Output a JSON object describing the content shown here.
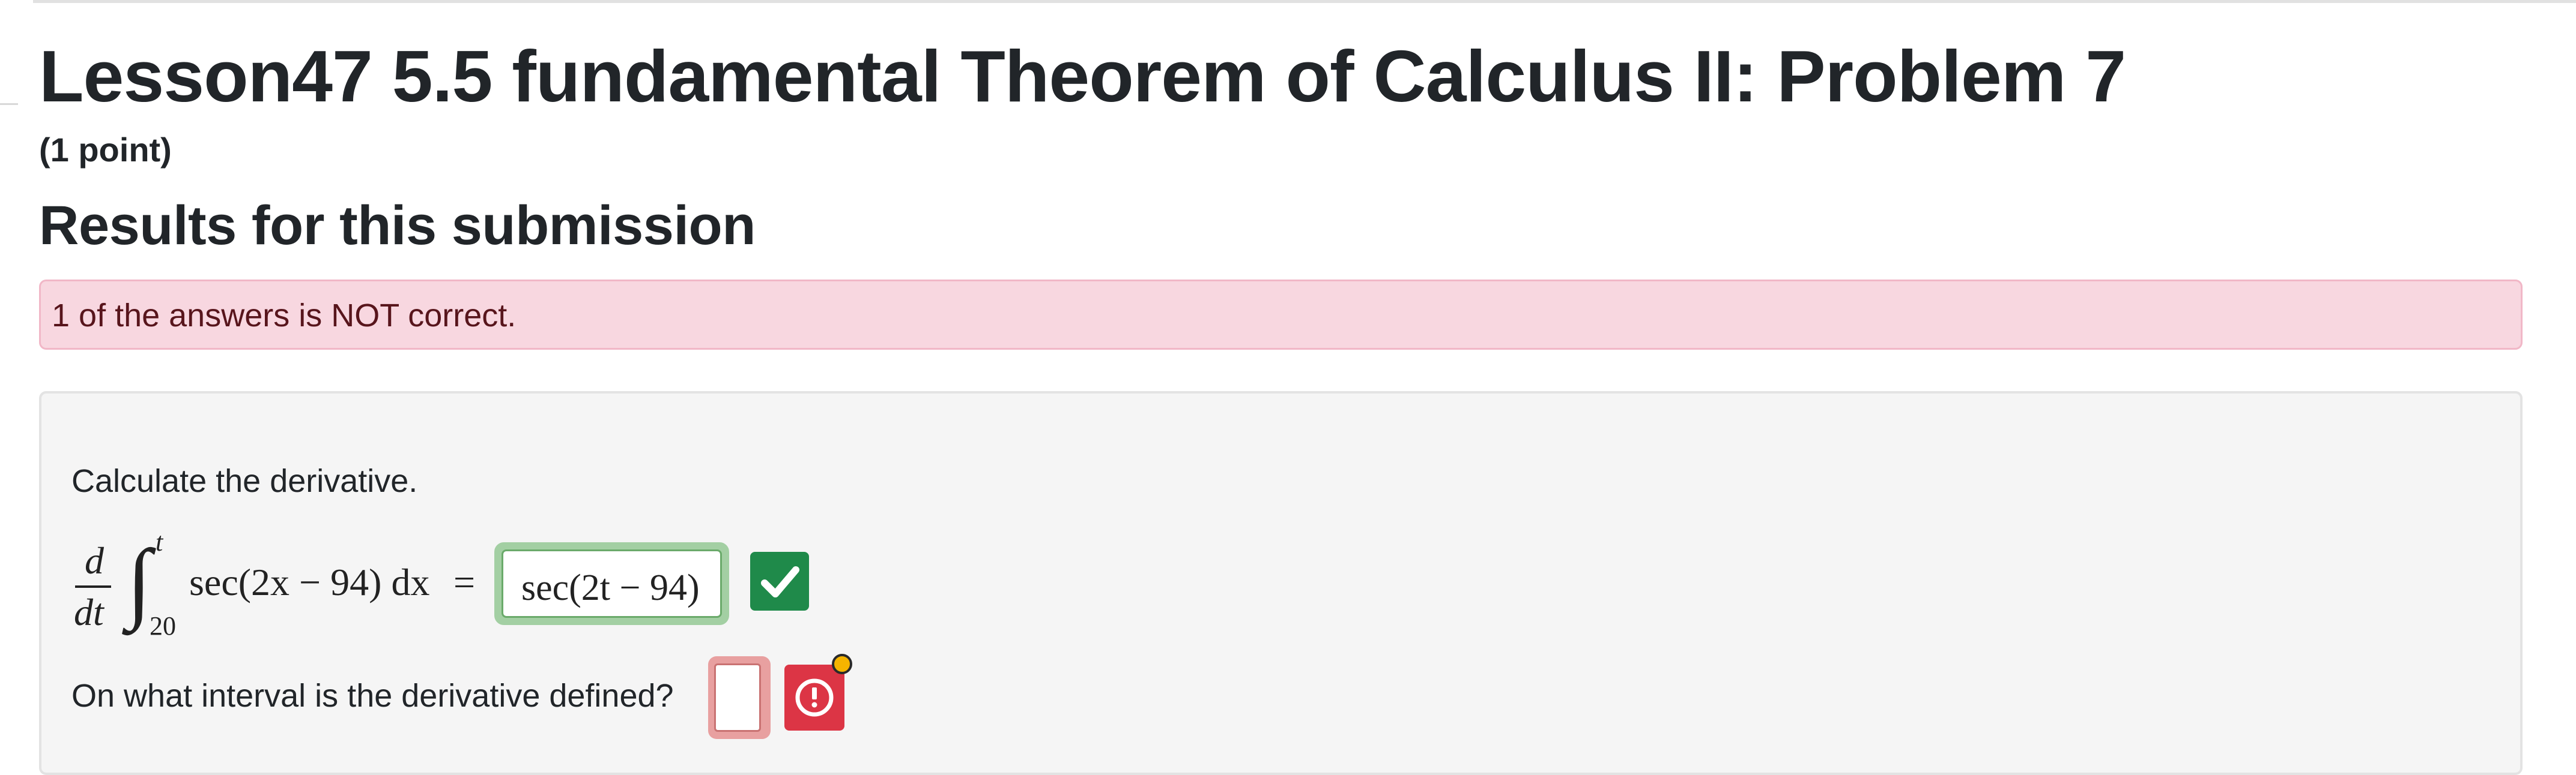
{
  "page": {
    "title": "Lesson47 5.5 fundamental Theorem of Calculus II: Problem 7",
    "points": "(1 point)",
    "results_heading": "Results for this submission"
  },
  "alert": {
    "message": "1 of the answers is NOT correct.",
    "color": "#f8d7e0"
  },
  "problem": {
    "prompt": "Calculate the derivative.",
    "expression": {
      "numerator": "d",
      "denominator": "dt",
      "integral_sign": "∫",
      "upper_limit": "t",
      "lower_limit": "20",
      "integrand": "sec(2x − 94) dx",
      "equals": "="
    },
    "answer1": {
      "value": "sec(2t − 94)",
      "status": "correct",
      "status_color": "#1f8a4a",
      "status_icon": "check-icon"
    },
    "question2": "On what interval is the derivative defined?",
    "answer2": {
      "value": "",
      "status": "incorrect",
      "status_color": "#dc3545",
      "status_icon": "exclamation-circle-icon"
    }
  }
}
